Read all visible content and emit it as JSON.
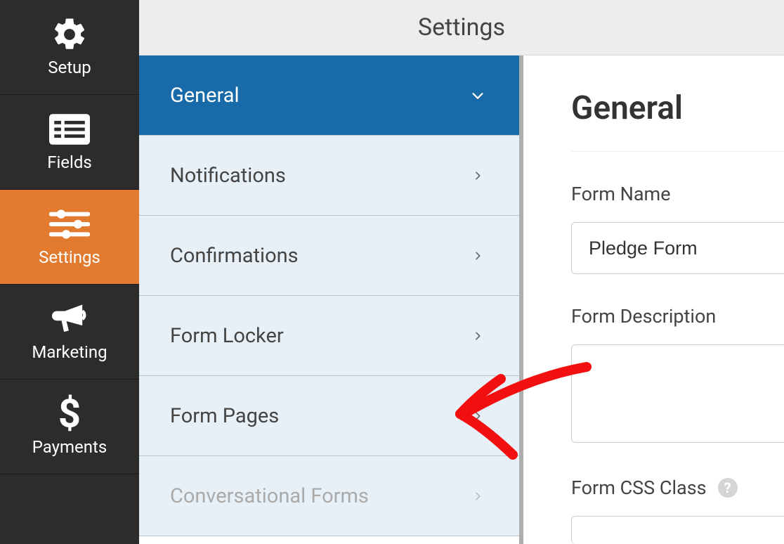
{
  "header": {
    "title": "Settings"
  },
  "leftNav": {
    "items": [
      {
        "label": "Setup"
      },
      {
        "label": "Fields"
      },
      {
        "label": "Settings"
      },
      {
        "label": "Marketing"
      },
      {
        "label": "Payments"
      }
    ]
  },
  "settingsMenu": {
    "items": [
      {
        "label": "General"
      },
      {
        "label": "Notifications"
      },
      {
        "label": "Confirmations"
      },
      {
        "label": "Form Locker"
      },
      {
        "label": "Form Pages"
      },
      {
        "label": "Conversational Forms"
      }
    ]
  },
  "content": {
    "heading": "General",
    "formNameLabel": "Form Name",
    "formNameValue": "Pledge Form",
    "formDescLabel": "Form Description",
    "formDescValue": "",
    "formCssLabel": "Form CSS Class",
    "helpTooltip": "?"
  }
}
